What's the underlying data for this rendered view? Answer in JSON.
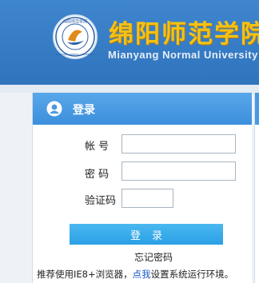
{
  "header": {
    "title": "绵阳师范学院",
    "subtitle": "Mianyang Normal University",
    "seal_text": "绵阳师范学院",
    "seal_text_en": "MIANYANG NORMAL UNIVERSITY"
  },
  "login": {
    "heading": "登录",
    "username_label": "帐 号",
    "username_value": "",
    "password_label": "密 码",
    "password_value": "",
    "captcha_label": "验证码",
    "captcha_value": "",
    "submit_label": "登录",
    "forgot_link": "忘记密码"
  },
  "footer": {
    "note_prefix": "推荐使用IE8+浏览器，",
    "note_link": "点我",
    "note_suffix": "设置系统运行环境。"
  },
  "colors": {
    "header_blue": "#3a7fc8",
    "title_gold": "#f5c214",
    "panel_head": "#4a99e2",
    "button": "#3aace9"
  }
}
